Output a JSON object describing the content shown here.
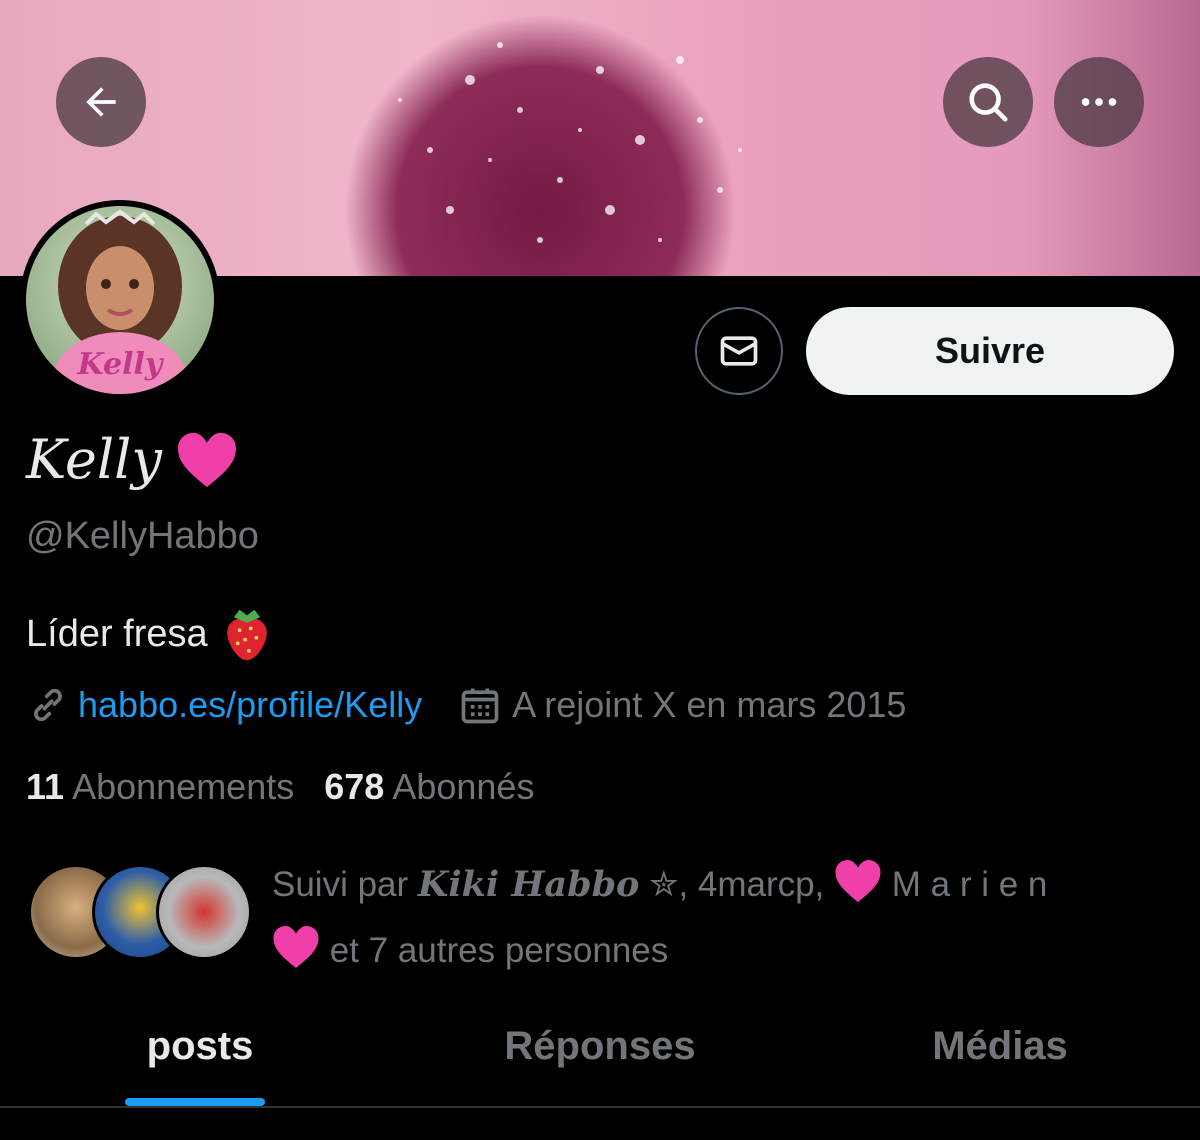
{
  "header": {
    "back_icon": "arrow-left-icon",
    "search_icon": "search-icon",
    "more_icon": "more-horizontal-icon"
  },
  "profile": {
    "display_name": "Kelly",
    "name_emoji": "pink-heart",
    "handle": "@KellyHabbo",
    "bio": "Líder fresa",
    "bio_emoji": "strawberry",
    "avatar_text": "Kelly",
    "link": "habbo.es/profile/Kelly",
    "joined": "A rejoint X en mars 2015",
    "following_count": "11",
    "following_label": "Abonnements",
    "followers_count": "678",
    "followers_label": "Abonnés",
    "followed_by_prefix": "Suivi par ",
    "followed_by_user1": "Kiki Habbo",
    "followed_by_user1_suffix": " ✮, 4marcp, ",
    "followed_by_user2": " M a r i e n",
    "followed_by_suffix": " et 7 autres personnes"
  },
  "actions": {
    "message_icon": "envelope-icon",
    "follow_label": "Suivre"
  },
  "tabs": [
    {
      "label": "posts",
      "active": true
    },
    {
      "label": "Réponses",
      "active": false
    },
    {
      "label": "Médias",
      "active": false
    }
  ],
  "colors": {
    "accent": "#1d9bf0",
    "background": "#000000",
    "muted": "#71767b"
  }
}
